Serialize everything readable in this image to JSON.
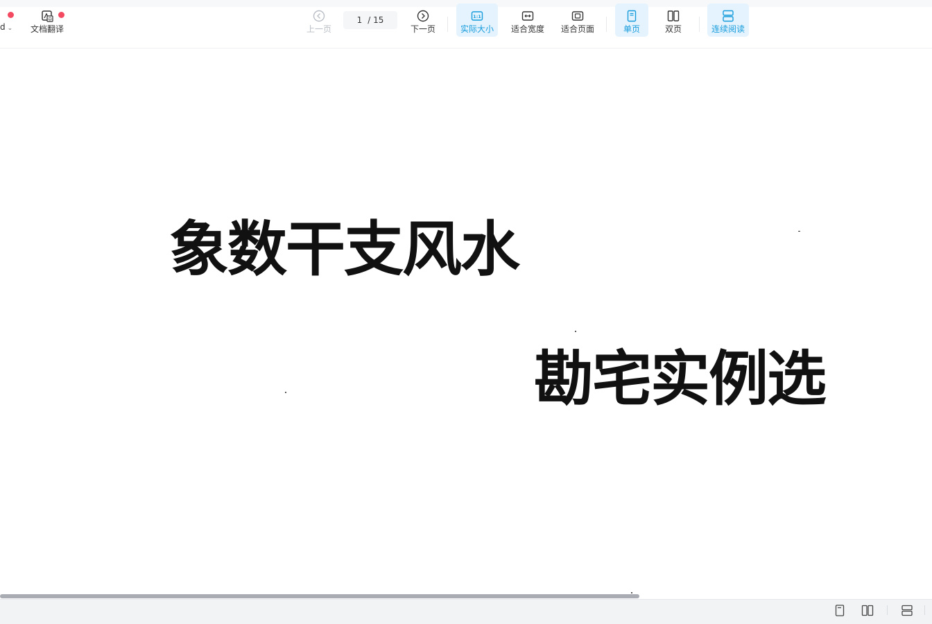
{
  "toolbar": {
    "left_cut_label": "d",
    "translate_label": "文档翻译",
    "prev_label": "上一页",
    "page_current": "1",
    "page_total": "/ 15",
    "next_label": "下一页",
    "actual_size_label": "实际大小",
    "fit_width_label": "适合宽度",
    "fit_page_label": "适合页面",
    "single_page_label": "单页",
    "double_page_label": "双页",
    "continuous_label": "连续阅读"
  },
  "document": {
    "title_line1": "象数干支风水",
    "title_line2": "勘宅实例选"
  },
  "colors": {
    "accent": "#159bdc",
    "active_bg": "#e4f3fd",
    "badge": "#f44a61"
  },
  "icons": [
    "chevron-down-icon",
    "translate-icon",
    "prev-page-icon",
    "next-page-icon",
    "actual-size-icon",
    "fit-width-icon",
    "fit-page-icon",
    "single-page-icon",
    "double-page-icon",
    "continuous-icon"
  ]
}
